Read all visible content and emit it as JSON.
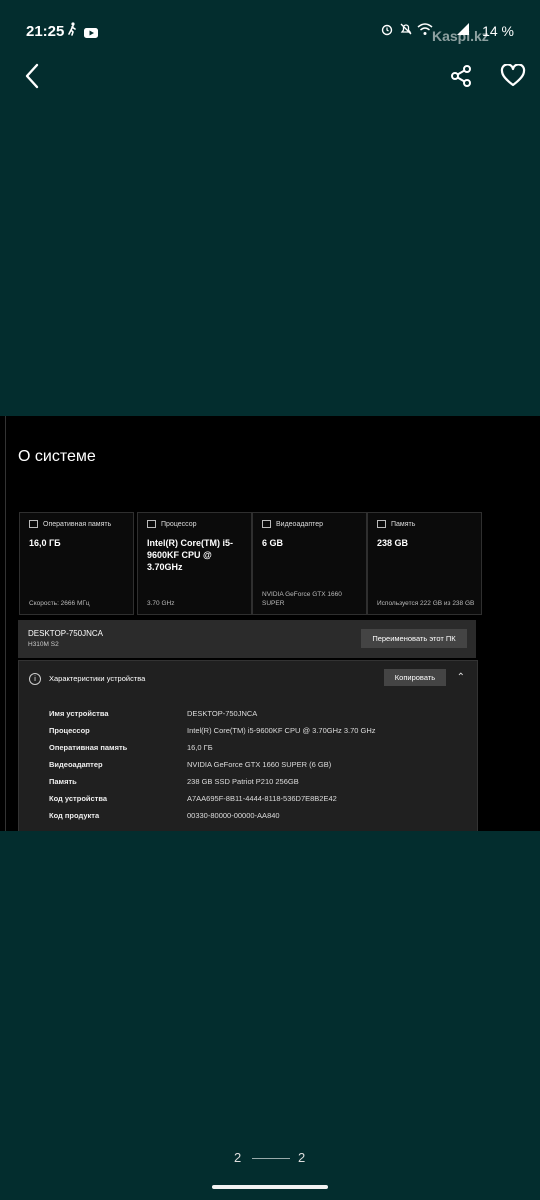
{
  "status": {
    "time": "21:25",
    "battery": "14 %",
    "watermark": "Kaspi.kz"
  },
  "window": {
    "title": "О системе",
    "cards": [
      {
        "label": "Оперативная память",
        "value": "16,0 ГБ",
        "footer": "Скорость: 2666 МГц"
      },
      {
        "label": "Процессор",
        "value": "Intel(R) Core(TM) i5-9600KF CPU @ 3.70GHz",
        "footer": "3.70 GHz"
      },
      {
        "label": "Видеоадаптер",
        "value": "6 GB",
        "footer": "NVIDIA GeForce GTX 1660 SUPER"
      },
      {
        "label": "Память",
        "value": "238 GB",
        "footer": "Используется 222 GB из 238 GB"
      }
    ],
    "pc": {
      "name": "DESKTOP-750JNCA",
      "model": "H310M S2",
      "rename_label": "Переименовать этот ПК"
    },
    "specs": {
      "title": "Характеристики устройства",
      "copy_label": "Копировать",
      "rows": [
        {
          "key": "Имя устройства",
          "value": "DESKTOP-750JNCA"
        },
        {
          "key": "Процессор",
          "value": "Intel(R) Core(TM) i5-9600KF CPU @ 3.70GHz   3.70 GHz"
        },
        {
          "key": "Оперативная память",
          "value": "16,0 ГБ"
        },
        {
          "key": "Видеоадаптер",
          "value": "NVIDIA GeForce GTX 1660 SUPER (6 GB)"
        },
        {
          "key": "Память",
          "value": "238 GB SSD Patriot P210 256GB"
        },
        {
          "key": "Код устройства",
          "value": "A7AA695F-8B11-4444-8118-536D7E8B2E42"
        },
        {
          "key": "Код продукта",
          "value": "00330-80000-00000-AA840"
        }
      ]
    }
  },
  "pager": {
    "current": "2",
    "total": "2"
  }
}
